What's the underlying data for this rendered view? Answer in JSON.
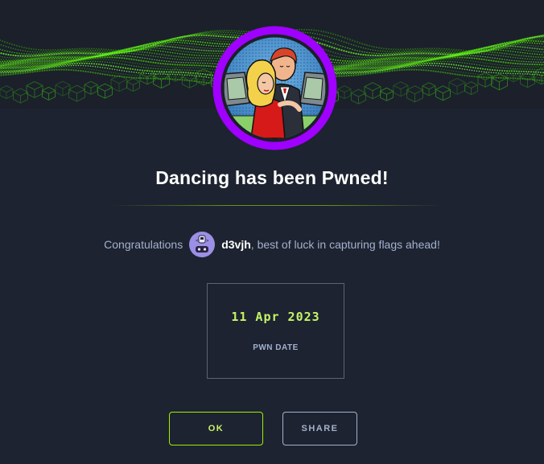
{
  "banner": {
    "icon": "green-cube-grid-banner"
  },
  "machine_badge": {
    "icon": "dancing-couple-machine-avatar",
    "ring_color": "#9f00ff"
  },
  "title": "Dancing has been Pwned!",
  "message": {
    "prefix": "Congratulations",
    "username": "d3vjh",
    "suffix": ", best of luck in capturing flags ahead!",
    "avatar_icon": "robot-avatar"
  },
  "pwn": {
    "date": "11 Apr 2023",
    "label": "PWN DATE"
  },
  "buttons": {
    "ok_label": "OK",
    "share_label": "SHARE"
  },
  "colors": {
    "background": "#1d2330",
    "accent_green": "#9fef00",
    "muted_text": "#a4b1cd"
  }
}
